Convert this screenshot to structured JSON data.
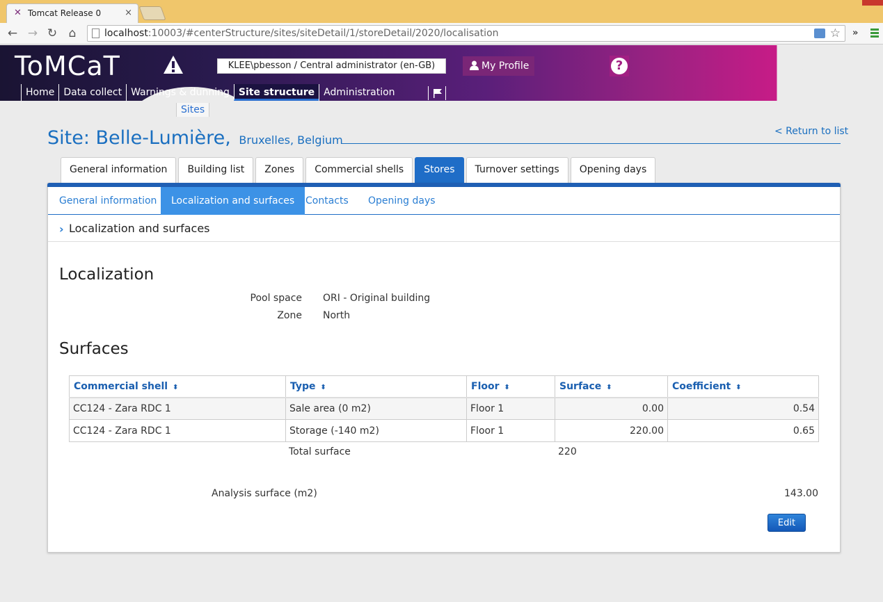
{
  "browser": {
    "tab_title": "Tomcat Release 0",
    "tab_close": "×",
    "url_host": "localhost",
    "url_rest": ":10003/#centerStructure/sites/siteDetail/1/storeDetail/2020/localisation",
    "more_label": "»"
  },
  "header": {
    "logo": "ToMCaT",
    "user": "KLEE\\pbesson / Central administrator (en-GB)",
    "profile": "My Profile",
    "help": "?",
    "menu": [
      "Home",
      "Data collect",
      "Warnings & dunning",
      "Site structure",
      "Administration"
    ],
    "submenu": "Sites"
  },
  "site": {
    "title": "Site: Belle-Lumière,",
    "location": "Bruxelles, Belgium",
    "return_link": "< Return to list"
  },
  "tabs": [
    "General information",
    "Building list",
    "Zones",
    "Commercial shells",
    "Stores",
    "Turnover settings",
    "Opening days"
  ],
  "subtabs": [
    "General information",
    "Localization and surfaces",
    "Contacts",
    "Opening days"
  ],
  "breadcrumb": "Localization and surfaces",
  "localization": {
    "heading": "Localization",
    "pool_space_label": "Pool space",
    "pool_space_value": "ORI - Original building",
    "zone_label": "Zone",
    "zone_value": "North"
  },
  "surfaces": {
    "heading": "Surfaces",
    "columns": [
      "Commercial shell",
      "Type",
      "Floor",
      "Surface",
      "Coefficient"
    ],
    "sort_glyph": "⬍",
    "rows": [
      [
        "CC124 - Zara RDC 1",
        "Sale area (0 m2)",
        "Floor 1",
        "0.00",
        "0.54"
      ],
      [
        "CC124 - Zara RDC 1",
        "Storage (-140 m2)",
        "Floor 1",
        "220.00",
        "0.65"
      ]
    ],
    "total_label": "Total surface",
    "total_value": "220",
    "analysis_label": "Analysis surface (m2)",
    "analysis_value": "143.00",
    "edit": "Edit"
  }
}
